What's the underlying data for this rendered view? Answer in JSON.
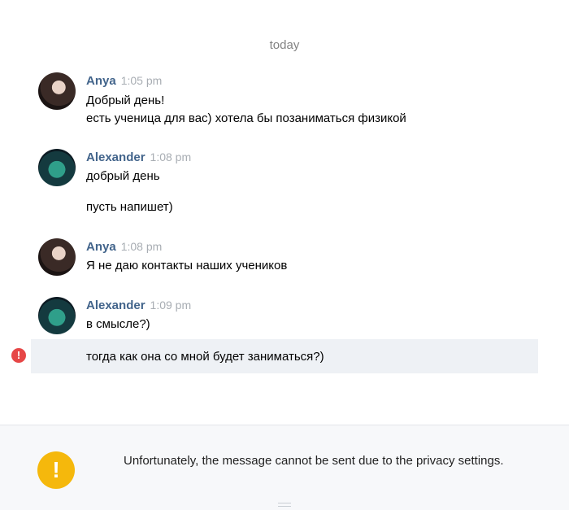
{
  "day_separator": "today",
  "messages": [
    {
      "author": "Anya",
      "time": "1:05 pm",
      "avatar": "anya-avatar",
      "lines": [
        "Добрый день!",
        "есть ученица для вас) хотела бы позаниматься физикой"
      ]
    },
    {
      "author": "Alexander",
      "time": "1:08 pm",
      "avatar": "alexander-avatar",
      "lines": [
        "добрый день",
        "пусть напишет)"
      ]
    },
    {
      "author": "Anya",
      "time": "1:08 pm",
      "avatar": "anya-avatar",
      "lines": [
        "Я не даю контакты наших учеников"
      ]
    },
    {
      "author": "Alexander",
      "time": "1:09 pm",
      "avatar": "alexander-avatar",
      "lines": [
        "в смысле?)"
      ]
    }
  ],
  "failed_message": {
    "text": "тогда как она со мной будет заниматься?)",
    "status_icon": "error-icon",
    "status_color": "#e64646"
  },
  "footer": {
    "warning_icon": "warning-icon",
    "warning_color": "#f5b80c",
    "warning_text": "Unfortunately, the message cannot be sent due to the privacy settings."
  },
  "colors": {
    "author": "#42648b",
    "timestamp": "#a8adb3",
    "failed_row_bg": "#eef1f5"
  }
}
